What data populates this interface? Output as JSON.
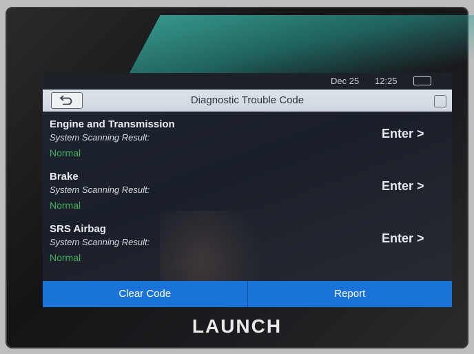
{
  "status_bar": {
    "date": "Dec 25",
    "time": "12:25"
  },
  "header": {
    "title": "Diagnostic Trouble Code"
  },
  "systems": [
    {
      "name": "Engine and Transmission",
      "subtitle": "System Scanning Result:",
      "status": "Normal",
      "enter_label": "Enter >"
    },
    {
      "name": "Brake",
      "subtitle": "System Scanning Result:",
      "status": "Normal",
      "enter_label": "Enter >"
    },
    {
      "name": "SRS Airbag",
      "subtitle": "System Scanning Result:",
      "status": "Normal",
      "enter_label": "Enter >"
    }
  ],
  "footer": {
    "clear_code_label": "Clear Code",
    "report_label": "Report"
  },
  "brand": "LAUNCH",
  "colors": {
    "accent": "#1a73d9",
    "status_normal": "#3fb35a",
    "title_bar": "#d6dde5"
  },
  "icons": {
    "back": "back-arrow-icon",
    "battery": "battery-icon",
    "corner": "screenshot-icon"
  }
}
